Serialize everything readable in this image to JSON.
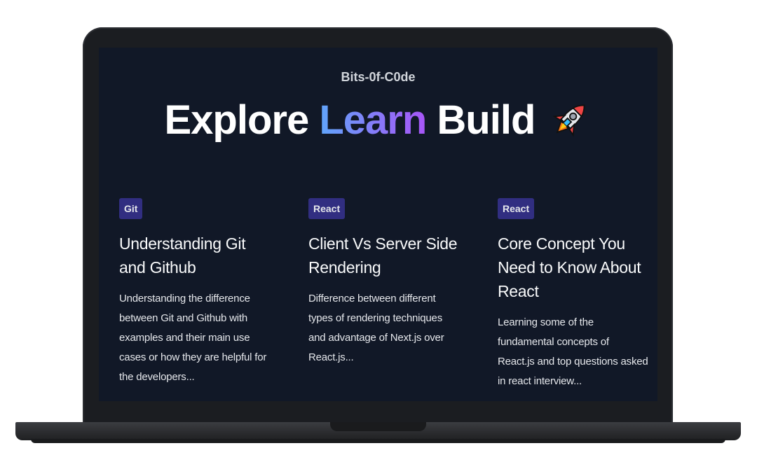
{
  "site": {
    "brand": "Bits-0f-C0de",
    "hero_word_1": "Explore",
    "hero_word_2": "Learn",
    "hero_word_3": "Build",
    "hero_icon": "rocket-icon"
  },
  "posts": [
    {
      "tag": "Git",
      "title": "Understanding Git and Github",
      "description": "Understanding the difference between Git and Github with examples and their main use cases or how they are helpful for the developers..."
    },
    {
      "tag": "React",
      "title": "Client Vs Server Side Rendering",
      "description": "Difference between different types of rendering techniques and advantage of Next.js over React.js..."
    },
    {
      "tag": "React",
      "title": "Core Concept You Need to Know About React",
      "description": "Learning some of the fundamental concepts of React.js and top questions asked in react interview..."
    }
  ],
  "colors": {
    "background": "#111827",
    "tag_background": "#312e81",
    "accent_gradient_start": "#60a5fa",
    "accent_gradient_end": "#a855f7"
  }
}
